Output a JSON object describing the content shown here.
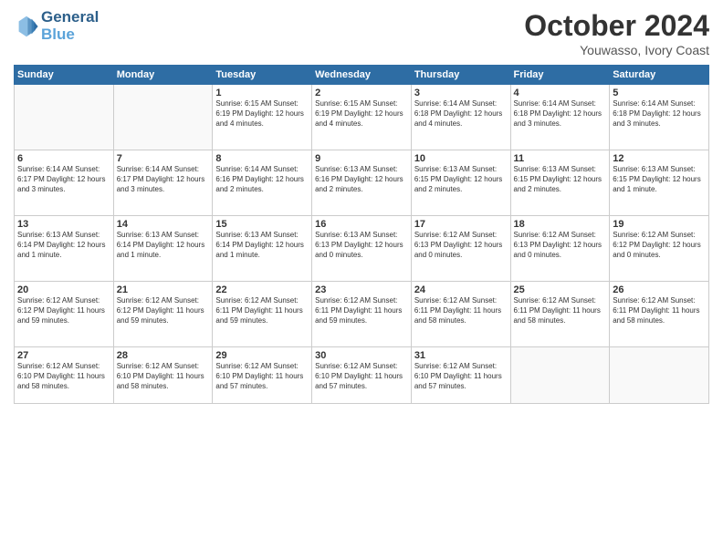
{
  "logo": {
    "line1": "General",
    "line2": "Blue"
  },
  "header": {
    "month": "October 2024",
    "location": "Youwasso, Ivory Coast"
  },
  "weekdays": [
    "Sunday",
    "Monday",
    "Tuesday",
    "Wednesday",
    "Thursday",
    "Friday",
    "Saturday"
  ],
  "weeks": [
    [
      {
        "day": "",
        "info": ""
      },
      {
        "day": "",
        "info": ""
      },
      {
        "day": "1",
        "info": "Sunrise: 6:15 AM\nSunset: 6:19 PM\nDaylight: 12 hours\nand 4 minutes."
      },
      {
        "day": "2",
        "info": "Sunrise: 6:15 AM\nSunset: 6:19 PM\nDaylight: 12 hours\nand 4 minutes."
      },
      {
        "day": "3",
        "info": "Sunrise: 6:14 AM\nSunset: 6:18 PM\nDaylight: 12 hours\nand 4 minutes."
      },
      {
        "day": "4",
        "info": "Sunrise: 6:14 AM\nSunset: 6:18 PM\nDaylight: 12 hours\nand 3 minutes."
      },
      {
        "day": "5",
        "info": "Sunrise: 6:14 AM\nSunset: 6:18 PM\nDaylight: 12 hours\nand 3 minutes."
      }
    ],
    [
      {
        "day": "6",
        "info": "Sunrise: 6:14 AM\nSunset: 6:17 PM\nDaylight: 12 hours\nand 3 minutes."
      },
      {
        "day": "7",
        "info": "Sunrise: 6:14 AM\nSunset: 6:17 PM\nDaylight: 12 hours\nand 3 minutes."
      },
      {
        "day": "8",
        "info": "Sunrise: 6:14 AM\nSunset: 6:16 PM\nDaylight: 12 hours\nand 2 minutes."
      },
      {
        "day": "9",
        "info": "Sunrise: 6:13 AM\nSunset: 6:16 PM\nDaylight: 12 hours\nand 2 minutes."
      },
      {
        "day": "10",
        "info": "Sunrise: 6:13 AM\nSunset: 6:15 PM\nDaylight: 12 hours\nand 2 minutes."
      },
      {
        "day": "11",
        "info": "Sunrise: 6:13 AM\nSunset: 6:15 PM\nDaylight: 12 hours\nand 2 minutes."
      },
      {
        "day": "12",
        "info": "Sunrise: 6:13 AM\nSunset: 6:15 PM\nDaylight: 12 hours\nand 1 minute."
      }
    ],
    [
      {
        "day": "13",
        "info": "Sunrise: 6:13 AM\nSunset: 6:14 PM\nDaylight: 12 hours\nand 1 minute."
      },
      {
        "day": "14",
        "info": "Sunrise: 6:13 AM\nSunset: 6:14 PM\nDaylight: 12 hours\nand 1 minute."
      },
      {
        "day": "15",
        "info": "Sunrise: 6:13 AM\nSunset: 6:14 PM\nDaylight: 12 hours\nand 1 minute."
      },
      {
        "day": "16",
        "info": "Sunrise: 6:13 AM\nSunset: 6:13 PM\nDaylight: 12 hours\nand 0 minutes."
      },
      {
        "day": "17",
        "info": "Sunrise: 6:12 AM\nSunset: 6:13 PM\nDaylight: 12 hours\nand 0 minutes."
      },
      {
        "day": "18",
        "info": "Sunrise: 6:12 AM\nSunset: 6:13 PM\nDaylight: 12 hours\nand 0 minutes."
      },
      {
        "day": "19",
        "info": "Sunrise: 6:12 AM\nSunset: 6:12 PM\nDaylight: 12 hours\nand 0 minutes."
      }
    ],
    [
      {
        "day": "20",
        "info": "Sunrise: 6:12 AM\nSunset: 6:12 PM\nDaylight: 11 hours\nand 59 minutes."
      },
      {
        "day": "21",
        "info": "Sunrise: 6:12 AM\nSunset: 6:12 PM\nDaylight: 11 hours\nand 59 minutes."
      },
      {
        "day": "22",
        "info": "Sunrise: 6:12 AM\nSunset: 6:11 PM\nDaylight: 11 hours\nand 59 minutes."
      },
      {
        "day": "23",
        "info": "Sunrise: 6:12 AM\nSunset: 6:11 PM\nDaylight: 11 hours\nand 59 minutes."
      },
      {
        "day": "24",
        "info": "Sunrise: 6:12 AM\nSunset: 6:11 PM\nDaylight: 11 hours\nand 58 minutes."
      },
      {
        "day": "25",
        "info": "Sunrise: 6:12 AM\nSunset: 6:11 PM\nDaylight: 11 hours\nand 58 minutes."
      },
      {
        "day": "26",
        "info": "Sunrise: 6:12 AM\nSunset: 6:11 PM\nDaylight: 11 hours\nand 58 minutes."
      }
    ],
    [
      {
        "day": "27",
        "info": "Sunrise: 6:12 AM\nSunset: 6:10 PM\nDaylight: 11 hours\nand 58 minutes."
      },
      {
        "day": "28",
        "info": "Sunrise: 6:12 AM\nSunset: 6:10 PM\nDaylight: 11 hours\nand 58 minutes."
      },
      {
        "day": "29",
        "info": "Sunrise: 6:12 AM\nSunset: 6:10 PM\nDaylight: 11 hours\nand 57 minutes."
      },
      {
        "day": "30",
        "info": "Sunrise: 6:12 AM\nSunset: 6:10 PM\nDaylight: 11 hours\nand 57 minutes."
      },
      {
        "day": "31",
        "info": "Sunrise: 6:12 AM\nSunset: 6:10 PM\nDaylight: 11 hours\nand 57 minutes."
      },
      {
        "day": "",
        "info": ""
      },
      {
        "day": "",
        "info": ""
      }
    ]
  ]
}
